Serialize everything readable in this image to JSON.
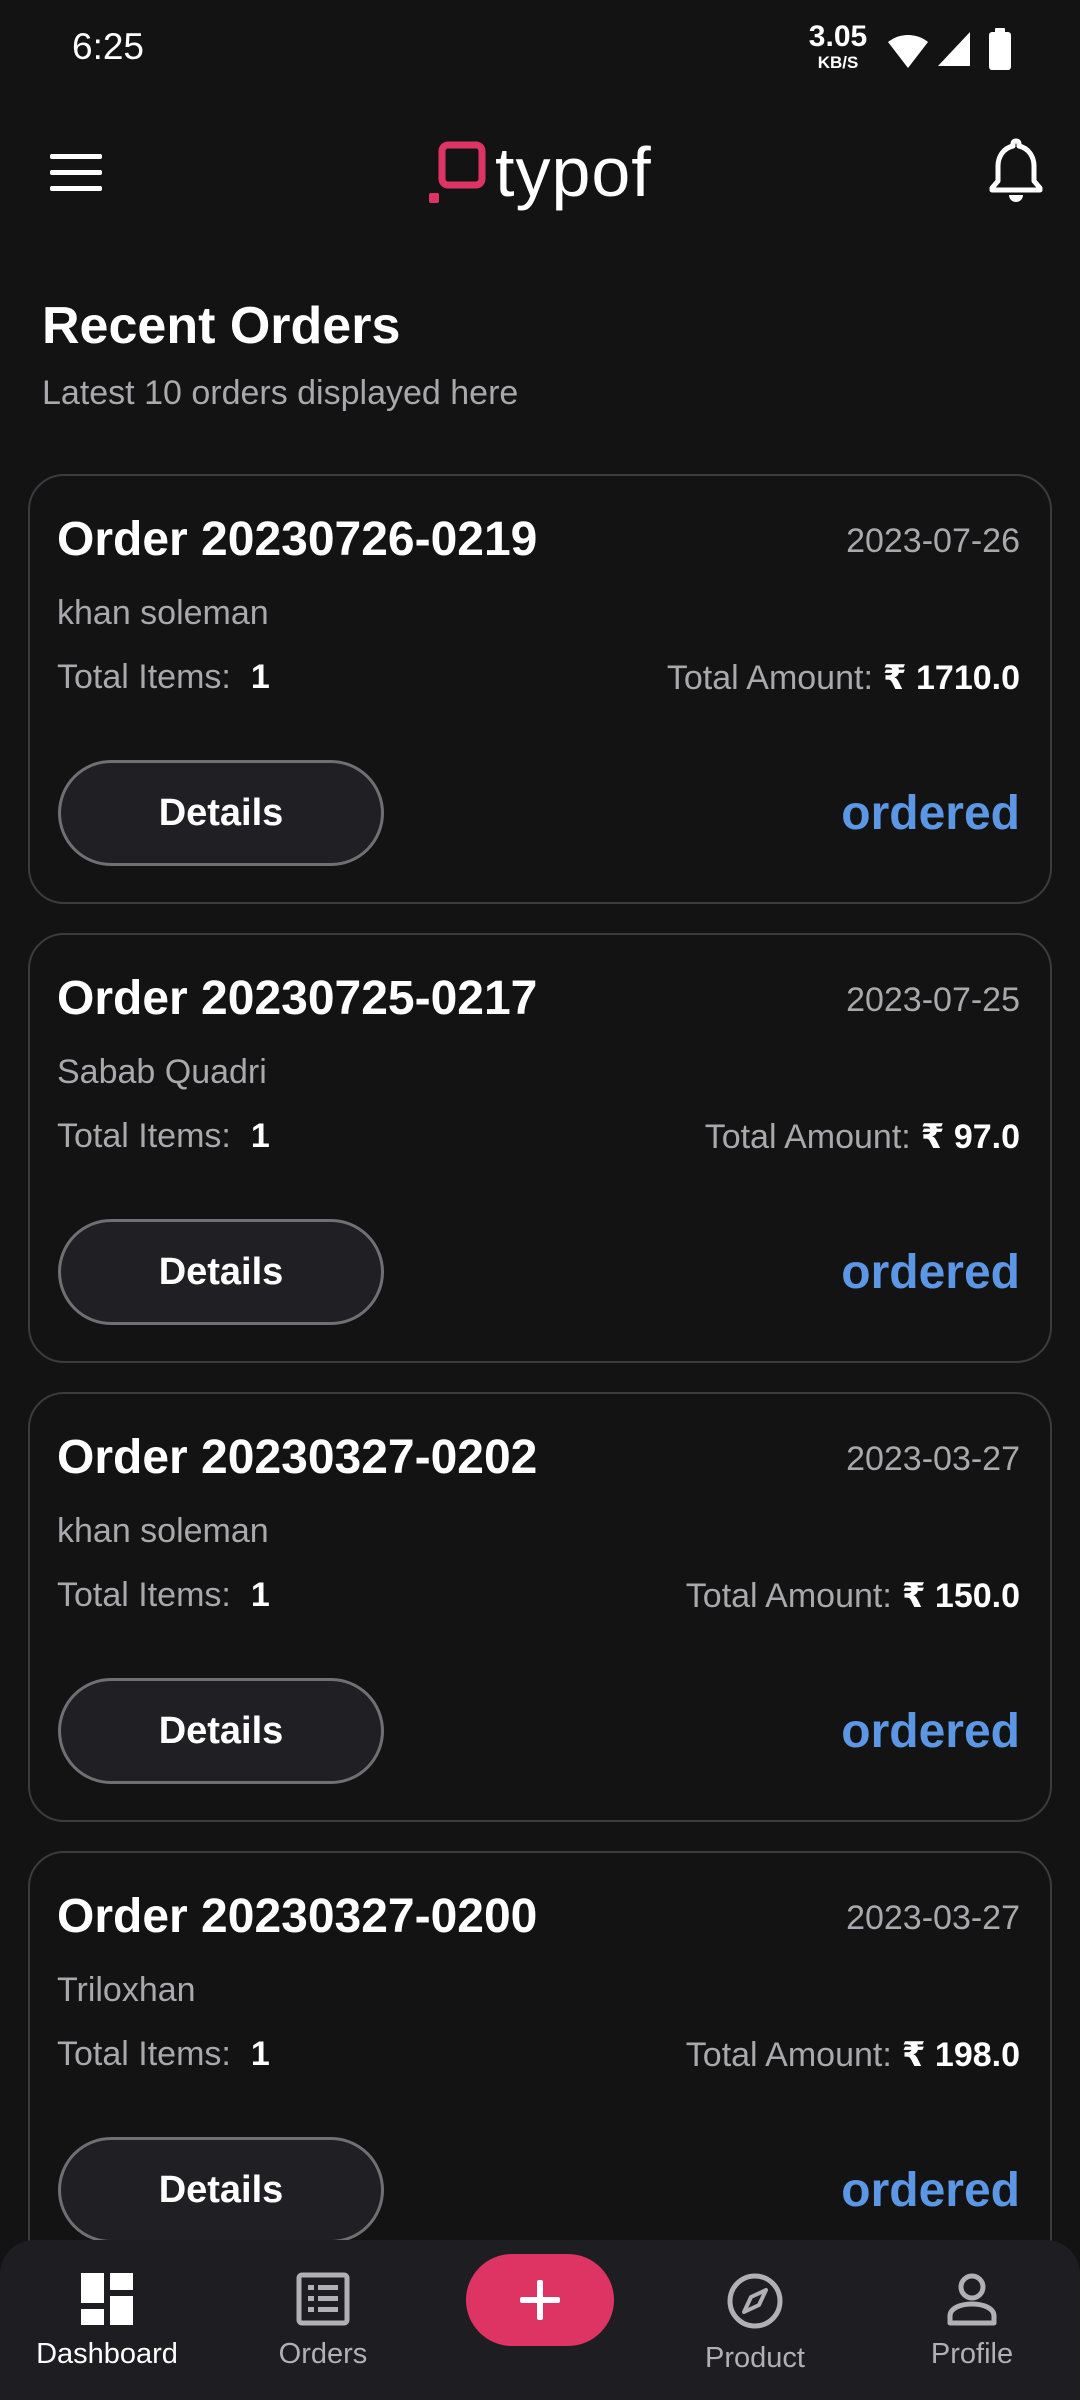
{
  "status_bar": {
    "time": "6:25",
    "speed_value": "3.05",
    "speed_unit": "KB/S",
    "icons": [
      "wifi-icon",
      "signal-icon",
      "battery-icon"
    ]
  },
  "app_bar": {
    "logo_text": "typof",
    "menu_icon": "menu-icon",
    "bell_icon": "bell-icon",
    "logo_accent": "#dd3464"
  },
  "header": {
    "title": "Recent Orders",
    "subtitle": "Latest 10 orders displayed here"
  },
  "orders": [
    {
      "title": "Order 20230726-0219",
      "date": "2023-07-26",
      "customer": "khan soleman",
      "items_label": "Total Items:",
      "items": "1",
      "amount_label": "Total Amount:",
      "amount": "₹ 1710.0",
      "details_label": "Details",
      "status": "ordered"
    },
    {
      "title": "Order 20230725-0217",
      "date": "2023-07-25",
      "customer": "Sabab Quadri",
      "items_label": "Total Items:",
      "items": "1",
      "amount_label": "Total Amount:",
      "amount": "₹ 97.0",
      "details_label": "Details",
      "status": "ordered"
    },
    {
      "title": "Order 20230327-0202",
      "date": "2023-03-27",
      "customer": "khan soleman",
      "items_label": "Total Items:",
      "items": "1",
      "amount_label": "Total Amount:",
      "amount": "₹ 150.0",
      "details_label": "Details",
      "status": "ordered"
    },
    {
      "title": "Order 20230327-0200",
      "date": "2023-03-27",
      "customer": "Triloxhan",
      "items_label": "Total Items:",
      "items": "1",
      "amount_label": "Total Amount:",
      "amount": "₹ 198.0",
      "details_label": "Details",
      "status": "ordered"
    }
  ],
  "colors": {
    "background": "#131314",
    "status_ordered": "#5b97e5",
    "fab": "#dd3464"
  },
  "bottom_nav": {
    "items": [
      {
        "label": "Dashboard",
        "icon": "dashboard-icon",
        "active": true
      },
      {
        "label": "Orders",
        "icon": "orders-list-icon",
        "active": false
      },
      {
        "label": "Product",
        "icon": "compass-icon",
        "active": false
      },
      {
        "label": "Profile",
        "icon": "person-icon",
        "active": false
      }
    ],
    "fab_icon": "plus-icon"
  }
}
